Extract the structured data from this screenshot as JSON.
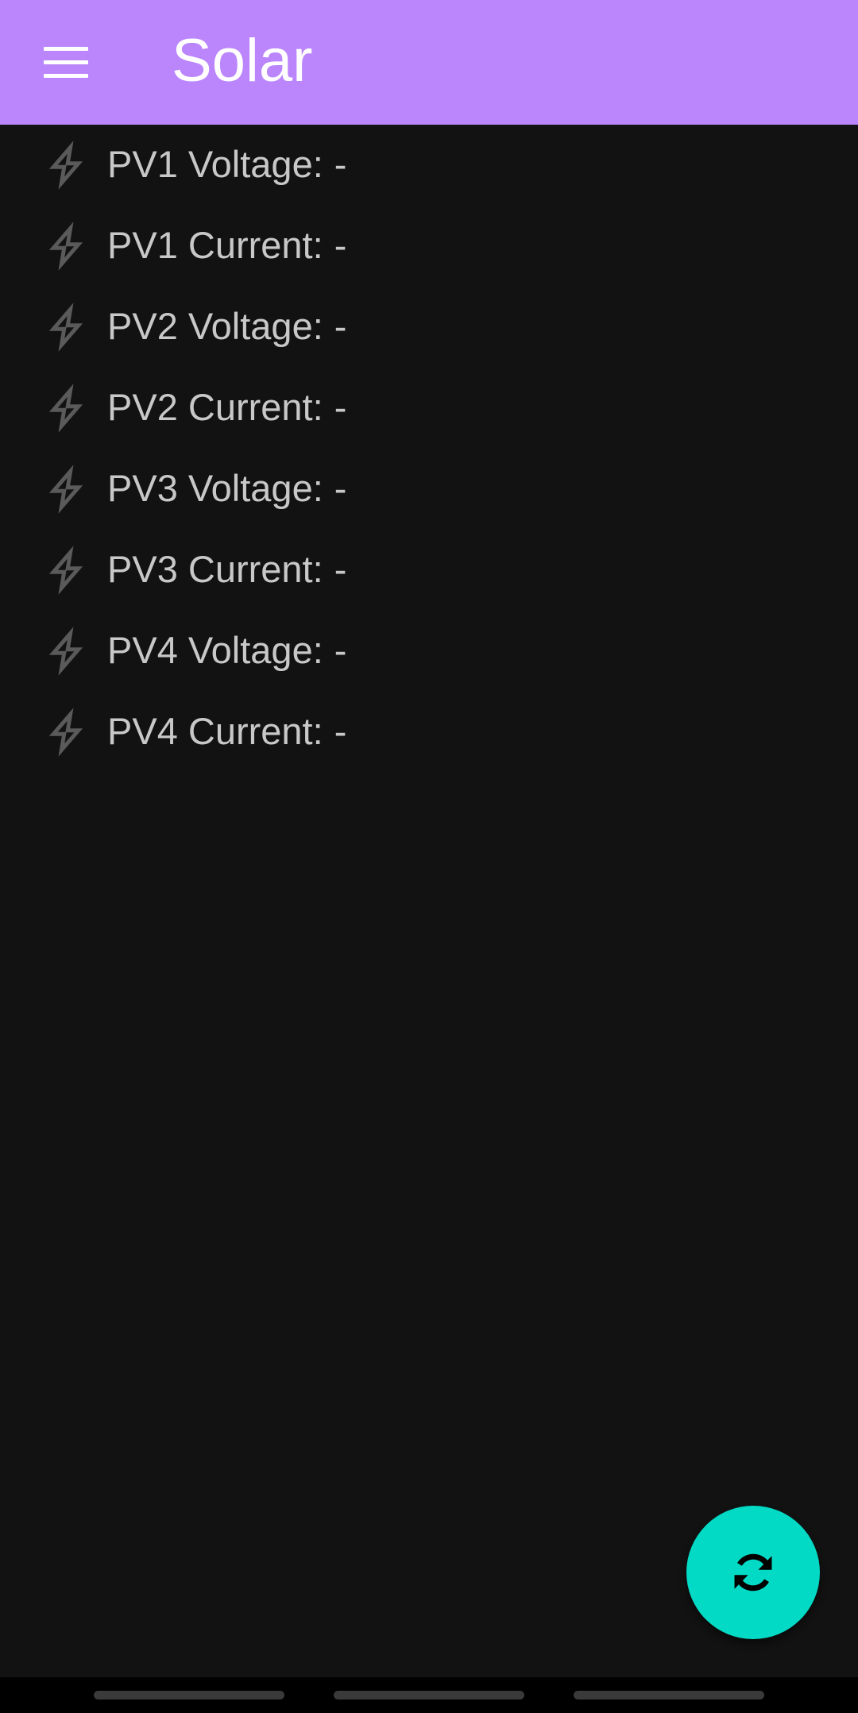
{
  "app_bar": {
    "title": "Solar",
    "icon": "menu-icon",
    "color": "#bb86fc"
  },
  "readings": [
    {
      "label": "PV1 Voltage:",
      "value": "-",
      "icon": "bolt-icon"
    },
    {
      "label": "PV1 Current:",
      "value": "-",
      "icon": "bolt-icon"
    },
    {
      "label": "PV2 Voltage:",
      "value": "-",
      "icon": "bolt-icon"
    },
    {
      "label": "PV2 Current:",
      "value": "-",
      "icon": "bolt-icon"
    },
    {
      "label": "PV3 Voltage:",
      "value": "-",
      "icon": "bolt-icon"
    },
    {
      "label": "PV3 Current:",
      "value": "-",
      "icon": "bolt-icon"
    },
    {
      "label": "PV4 Voltage:",
      "value": "-",
      "icon": "bolt-icon"
    },
    {
      "label": "PV4 Current:",
      "value": "-",
      "icon": "bolt-icon"
    }
  ],
  "fab": {
    "icon": "refresh-icon",
    "color": "#03dac5"
  },
  "theme": {
    "background": "#121212",
    "text": "#c8c8c8",
    "icon": "#5a5a5a"
  }
}
